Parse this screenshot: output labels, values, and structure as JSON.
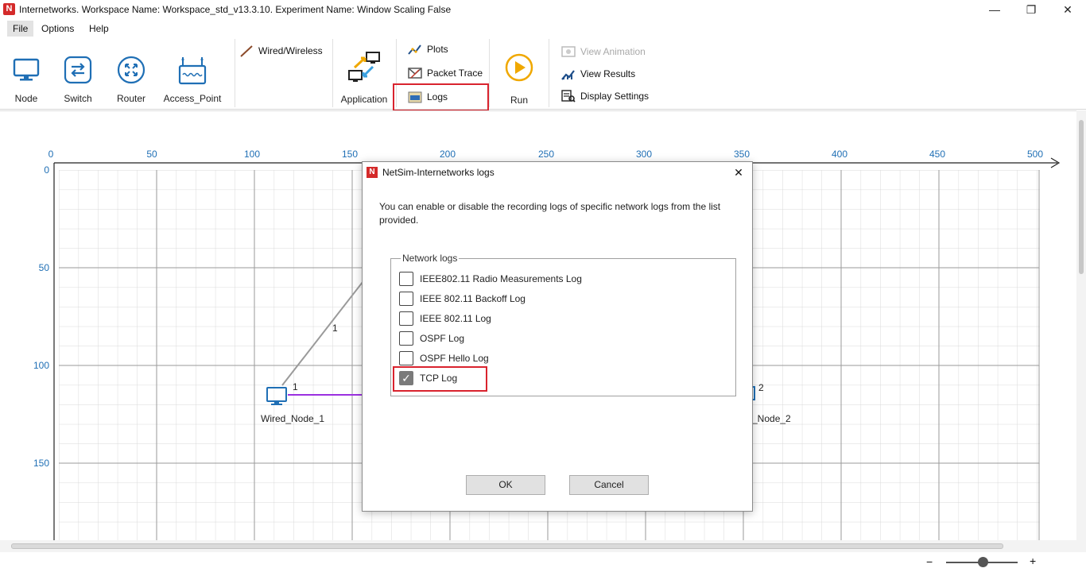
{
  "window": {
    "title": "Internetworks. Workspace Name: Workspace_std_v13.3.10. Experiment Name: Window Scaling False",
    "app_icon": "N",
    "minimize": "—",
    "maximize": "❐",
    "close": "✕"
  },
  "menu": {
    "items": [
      "File",
      "Options",
      "Help"
    ]
  },
  "ribbon": {
    "node": "Node",
    "switch": "Switch",
    "router": "Router",
    "access_point": "Access_Point",
    "wired_wireless": "Wired/Wireless",
    "application": "Application",
    "plots": "Plots",
    "packet_trace": "Packet Trace",
    "logs": "Logs",
    "run": "Run",
    "view_animation": "View Animation",
    "view_results": "View Results",
    "display_settings": "Display Settings"
  },
  "canvas": {
    "x_ticks": [
      "0",
      "50",
      "100",
      "150",
      "200",
      "250",
      "300",
      "350",
      "400",
      "450",
      "500"
    ],
    "y_ticks": [
      "0",
      "50",
      "100",
      "150"
    ],
    "node1_label": "Wired_Node_1",
    "node2_label": "_Node_2",
    "link_label_a": "1",
    "link_label_b": "1",
    "link_label_c": "2"
  },
  "dialog": {
    "title": "NetSim-Internetworks logs",
    "close": "✕",
    "description": "You can enable or disable the recording logs of specific network logs from the list provided.",
    "group_label": "Network logs",
    "logs": [
      {
        "label": "IEEE802.11 Radio Measurements Log",
        "checked": false
      },
      {
        "label": "IEEE 802.11 Backoff Log",
        "checked": false
      },
      {
        "label": "IEEE 802.11 Log",
        "checked": false
      },
      {
        "label": "OSPF Log",
        "checked": false
      },
      {
        "label": "OSPF Hello Log",
        "checked": false
      },
      {
        "label": "TCP Log",
        "checked": true
      }
    ],
    "ok": "OK",
    "cancel": "Cancel"
  },
  "statusbar": {
    "zoom_minus": "−",
    "zoom_plus": "+"
  },
  "colors": {
    "accent_blue": "#1f6fb5",
    "highlight_red": "#d9232e",
    "link_purple": "#9b30e0"
  }
}
